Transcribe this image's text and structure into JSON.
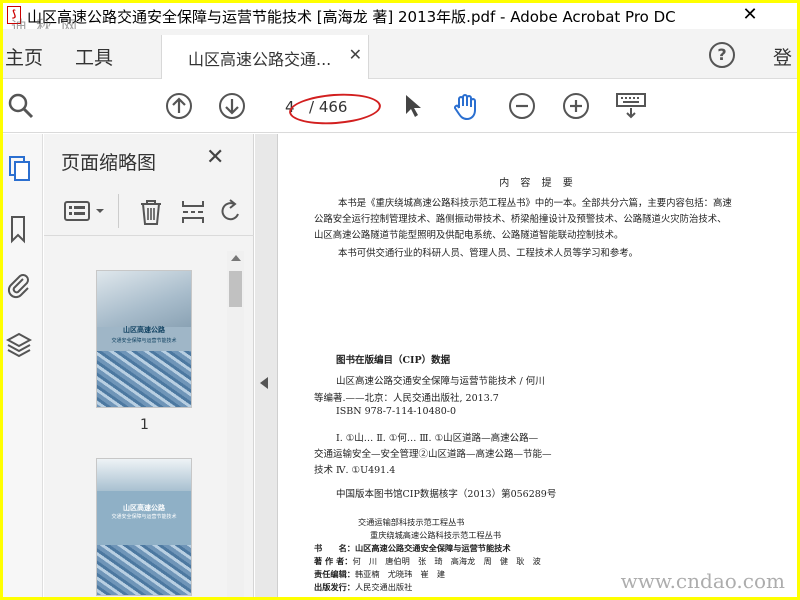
{
  "window": {
    "title": "山区高速公路交通安全保障与运营节能技术 [高海龙 著] 2013年版.pdf - Adobe Acrobat Pro DC",
    "close_glyph": "✕",
    "watermark_top": "迪 秋 网"
  },
  "menu": {
    "home": "主页",
    "tools": "工具",
    "doc_tab_label": "山区高速公路交通...",
    "doc_tab_close": "✕",
    "help": "?",
    "login": "登"
  },
  "toolbar": {
    "page_current": "4",
    "page_total": "/ 466",
    "icons": [
      "search-icon",
      "prev-page-icon",
      "next-page-icon",
      "select-arrow-icon",
      "hand-tool-icon",
      "zoom-out-icon",
      "zoom-in-icon",
      "keyboard-icon"
    ]
  },
  "thumbnail_panel": {
    "title": "页面缩略图",
    "close_glyph": "✕",
    "thumbs": [
      {
        "number": "1",
        "cover_title": "山区高速公路",
        "cover_subtitle": "交通安全保障与运营节能技术"
      },
      {
        "number": "",
        "cover_title": "山区高速公路",
        "cover_subtitle": "交通安全保障与运营节能技术"
      }
    ]
  },
  "document": {
    "heading": "内 容 提 要",
    "summary_lines": [
      "本书是《重庆绕城高速公路科技示范工程丛书》中的一本。全部共分六篇，主要内容包括：高速",
      "公路安全运行控制管理技术、路侧振动带技术、桥梁船撞设计及预警技术、公路隧道火灾防治技术、",
      "山区高速公路隧道节能型照明及供配电系统、公路隧道智能联动控制技术。",
      "本书可供交通行业的科研人员、管理人员、工程技术人员等学习和参考。"
    ],
    "cip_title": "图书在版编目（CIP）数据",
    "cip_lines": [
      "山区高速公路交通安全保障与运营节能技术 / 何川",
      "等编著.——北京：人民交通出版社, 2013.7",
      "ISBN 978-7-114-10480-0",
      "Ⅰ. ①山…  Ⅱ. ①何…  Ⅲ. ①山区道路—高速公路—",
      "交通运输安全—安全管理②山区道路—高速公路—节能—",
      "技术  Ⅳ. ①U491.4",
      "中国版本图书馆CIP数据核字（2013）第056289号"
    ],
    "series_lines": [
      "交通运输部科技示范工程丛书",
      "重庆绕城高速公路科技示范工程丛书"
    ],
    "credits": [
      {
        "label": "书　　名：",
        "value": "山区高速公路交通安全保障与运营节能技术"
      },
      {
        "label": "著 作 者：",
        "value": "何　川　唐伯明　张　琦　高海龙　周　健　耿　波"
      },
      {
        "label": "责任编辑：",
        "value": "韩亚楠　尤晓玮　崔　建"
      },
      {
        "label": "出版发行：",
        "value": "人民交通出版社"
      }
    ]
  },
  "watermark_bottom": "www.cndao.com",
  "colors": {
    "frame": "#ffff00",
    "annotation_ellipse": "#d21f1f",
    "hand_tool": "#2b6fd0"
  }
}
